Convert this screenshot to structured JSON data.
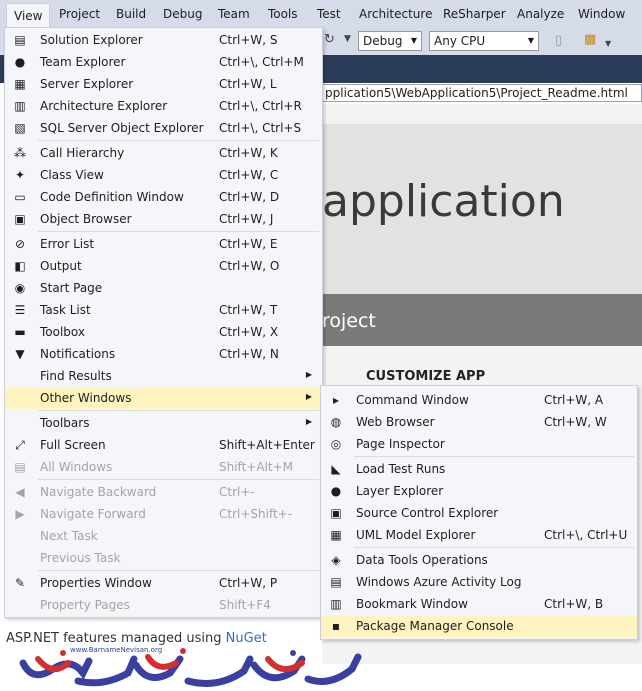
{
  "menubar": [
    "View",
    "Project",
    "Build",
    "Debug",
    "Team",
    "Tools",
    "Test",
    "Architecture",
    "ReSharper",
    "Analyze",
    "Window"
  ],
  "toolbar": {
    "config": "Debug",
    "platform": "Any CPU"
  },
  "address": "pplication5\\WebApplication5\\Project_Readme.html",
  "page": {
    "hero": "application",
    "band": "roject",
    "customize": "CUSTOMIZE APP",
    "bottom_text": "ASP.NET features managed using",
    "bottom_link": "NuGet"
  },
  "view_menu": [
    {
      "icon": "solution-explorer-icon",
      "glyph": "▤",
      "label": "Solution Explorer",
      "shortcut": "Ctrl+W, S"
    },
    {
      "icon": "team-explorer-icon",
      "glyph": "●",
      "label": "Team Explorer",
      "shortcut": "Ctrl+\\, Ctrl+M"
    },
    {
      "icon": "server-explorer-icon",
      "glyph": "▦",
      "label": "Server Explorer",
      "shortcut": "Ctrl+W, L"
    },
    {
      "icon": "architecture-explorer-icon",
      "glyph": "▥",
      "label": "Architecture Explorer",
      "shortcut": "Ctrl+\\, Ctrl+R"
    },
    {
      "icon": "sql-server-icon",
      "glyph": "▧",
      "label": "SQL Server Object Explorer",
      "shortcut": "Ctrl+\\, Ctrl+S"
    },
    {
      "sep": true
    },
    {
      "icon": "call-hierarchy-icon",
      "glyph": "⁂",
      "label": "Call Hierarchy",
      "shortcut": "Ctrl+W, K"
    },
    {
      "icon": "class-view-icon",
      "glyph": "✦",
      "label": "Class View",
      "shortcut": "Ctrl+W, C"
    },
    {
      "icon": "code-definition-icon",
      "glyph": "▭",
      "label": "Code Definition Window",
      "shortcut": "Ctrl+W, D"
    },
    {
      "icon": "object-browser-icon",
      "glyph": "▣",
      "label": "Object Browser",
      "shortcut": "Ctrl+W, J"
    },
    {
      "sep": true
    },
    {
      "icon": "error-list-icon",
      "glyph": "⊘",
      "label": "Error List",
      "shortcut": "Ctrl+W, E"
    },
    {
      "icon": "output-icon",
      "glyph": "◧",
      "label": "Output",
      "shortcut": "Ctrl+W, O"
    },
    {
      "icon": "start-page-icon",
      "glyph": "◉",
      "label": "Start Page",
      "shortcut": ""
    },
    {
      "icon": "task-list-icon",
      "glyph": "☰",
      "label": "Task List",
      "shortcut": "Ctrl+W, T"
    },
    {
      "icon": "toolbox-icon",
      "glyph": "▬",
      "label": "Toolbox",
      "shortcut": "Ctrl+W, X"
    },
    {
      "icon": "notifications-icon",
      "glyph": "▼",
      "label": "Notifications",
      "shortcut": "Ctrl+W, N"
    },
    {
      "icon": "",
      "glyph": "",
      "label": "Find Results",
      "shortcut": "",
      "submenu": true
    },
    {
      "icon": "",
      "glyph": "",
      "label": "Other Windows",
      "shortcut": "",
      "submenu": true,
      "highlight": true
    },
    {
      "sep": true
    },
    {
      "icon": "",
      "glyph": "",
      "label": "Toolbars",
      "shortcut": "",
      "submenu": true
    },
    {
      "icon": "full-screen-icon",
      "glyph": "⤢",
      "label": "Full Screen",
      "shortcut": "Shift+Alt+Enter"
    },
    {
      "icon": "all-windows-icon",
      "glyph": "▤",
      "label": "All Windows",
      "shortcut": "Shift+Alt+M",
      "disabled": true
    },
    {
      "sep": true
    },
    {
      "icon": "navigate-backward-icon",
      "glyph": "◀",
      "label": "Navigate Backward",
      "shortcut": "Ctrl+-",
      "disabled": true
    },
    {
      "icon": "navigate-forward-icon",
      "glyph": "▶",
      "label": "Navigate Forward",
      "shortcut": "Ctrl+Shift+-",
      "disabled": true
    },
    {
      "icon": "",
      "glyph": "",
      "label": "Next Task",
      "shortcut": "",
      "disabled": true
    },
    {
      "icon": "",
      "glyph": "",
      "label": "Previous Task",
      "shortcut": "",
      "disabled": true
    },
    {
      "sep": true
    },
    {
      "icon": "properties-window-icon",
      "glyph": "✎",
      "label": "Properties Window",
      "shortcut": "Ctrl+W, P"
    },
    {
      "icon": "",
      "glyph": "",
      "label": "Property Pages",
      "shortcut": "Shift+F4",
      "disabled": true
    }
  ],
  "other_windows_menu": [
    {
      "icon": "command-window-icon",
      "glyph": "▸",
      "label": "Command Window",
      "shortcut": "Ctrl+W, A"
    },
    {
      "icon": "web-browser-icon",
      "glyph": "◍",
      "label": "Web Browser",
      "shortcut": "Ctrl+W, W"
    },
    {
      "icon": "page-inspector-icon",
      "glyph": "◎",
      "label": "Page Inspector",
      "shortcut": ""
    },
    {
      "sep": true
    },
    {
      "icon": "load-test-runs-icon",
      "glyph": "◣",
      "label": "Load Test Runs",
      "shortcut": ""
    },
    {
      "icon": "layer-explorer-icon",
      "glyph": "●",
      "label": "Layer Explorer",
      "shortcut": ""
    },
    {
      "icon": "source-control-icon",
      "glyph": "▣",
      "label": "Source Control Explorer",
      "shortcut": ""
    },
    {
      "icon": "uml-model-icon",
      "glyph": "▦",
      "label": "UML Model Explorer",
      "shortcut": "Ctrl+\\, Ctrl+U"
    },
    {
      "sep": true
    },
    {
      "icon": "data-tools-icon",
      "glyph": "◈",
      "label": "Data Tools Operations",
      "shortcut": ""
    },
    {
      "icon": "azure-activity-icon",
      "glyph": "▤",
      "label": "Windows Azure Activity Log",
      "shortcut": ""
    },
    {
      "icon": "bookmark-window-icon",
      "glyph": "▥",
      "label": "Bookmark Window",
      "shortcut": "Ctrl+W, B"
    },
    {
      "icon": "package-manager-icon",
      "glyph": "▪",
      "label": "Package Manager Console",
      "shortcut": "",
      "highlight": true
    }
  ]
}
